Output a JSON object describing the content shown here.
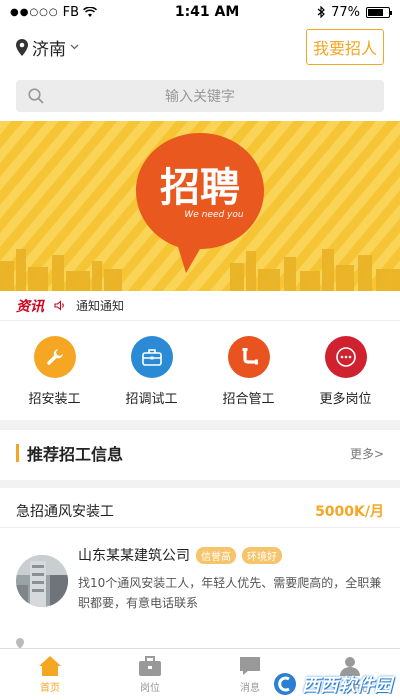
{
  "status_bar": {
    "carrier": "FB",
    "time": "1:41 AM",
    "battery": "77%",
    "battery_level": 0.77
  },
  "header": {
    "city": "济南",
    "post_job_label": "我要招人"
  },
  "search": {
    "placeholder": "输入关键字"
  },
  "banner": {
    "title": "招聘",
    "subtitle": "We need you"
  },
  "ticker": {
    "tag": "资讯",
    "text": "通知通知"
  },
  "categories": [
    {
      "label": "招安装工",
      "color": "#f5a623",
      "icon": "wrench-icon"
    },
    {
      "label": "招调试工",
      "color": "#2a8ad4",
      "icon": "toolbox-icon"
    },
    {
      "label": "招合管工",
      "color": "#e8531f",
      "icon": "pipe-icon"
    },
    {
      "label": "更多岗位",
      "color": "#d0212f",
      "icon": "more-icon"
    }
  ],
  "section": {
    "title": "推荐招工信息",
    "more": "更多>"
  },
  "job": {
    "title": "急招通风安装工",
    "salary": "5000K/月",
    "company": "山东某某建筑公司",
    "badges": [
      "信誉高",
      "环境好"
    ],
    "description": "找10个通风安装工人，年轻人优先、需要爬高的，全职兼职都要，有意电话联系"
  },
  "tabs": [
    {
      "label": "首页",
      "icon": "home-icon",
      "active": true
    },
    {
      "label": "岗位",
      "icon": "briefcase-icon",
      "active": false
    },
    {
      "label": "消息",
      "icon": "message-icon",
      "active": false
    },
    {
      "label": "个人中心",
      "icon": "user-icon",
      "active": false
    }
  ],
  "watermark": {
    "text": "西西软件园",
    "url": "CR173.COM"
  }
}
